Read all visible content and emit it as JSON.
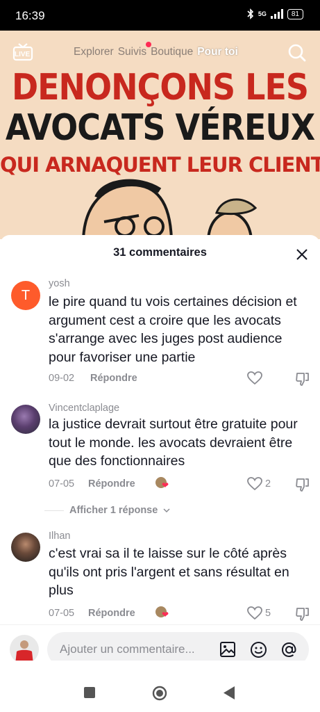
{
  "status": {
    "time": "16:39",
    "network": "5G",
    "battery": "81"
  },
  "topnav": {
    "live_label": "LIVE",
    "tabs": [
      "Explorer",
      "Suivis",
      "Boutique",
      "Pour toi"
    ]
  },
  "poster": {
    "line1": "DENONÇONS LES",
    "line2": "AVOCATS VÉREUX",
    "line3": "QUI ARNAQUENT LEUR CLIENT!"
  },
  "comments_header": {
    "title": "31 commentaires"
  },
  "comments": [
    {
      "username": "yosh",
      "avatar_letter": "T",
      "text": "le pire quand tu vois certaines décision et argument cest a croire que les avocats s'arrange avec les juges post audience pour favoriser une partie",
      "date": "09-02",
      "reply_label": "Répondre",
      "likes": ""
    },
    {
      "username": "Vincentclaplage",
      "text": "la justice devrait surtout être gratuite pour tout le monde. les avocats devraient être que des fonctionnaires",
      "date": "07-05",
      "reply_label": "Répondre",
      "likes": "2",
      "view_replies": "Afficher 1 réponse"
    },
    {
      "username": "Ilhan",
      "text": "c'est vrai sa il te laisse sur le côté après qu'ils ont pris l'argent et sans résultat en plus",
      "date": "07-05",
      "reply_label": "Répondre",
      "likes": "5"
    }
  ],
  "input": {
    "placeholder": "Ajouter un commentaire..."
  },
  "colors": {
    "accent": "#fe2c55",
    "poster_red": "#c8281e",
    "poster_bg": "#f5dcc2",
    "avatar_orange": "#fe5b2b"
  },
  "icons": [
    "live-icon",
    "search-icon",
    "close-icon",
    "heart-icon",
    "dislike-icon",
    "image-icon",
    "emoji-icon",
    "at-icon",
    "square-icon",
    "circle-icon",
    "back-icon"
  ]
}
